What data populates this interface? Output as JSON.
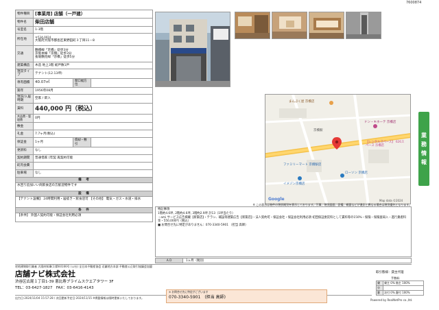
{
  "doc_id": "7600874",
  "property": {
    "type_label": "物件種目",
    "type_value": "[事業用] 店舗（一戸建）",
    "name_label": "物件名",
    "name_value": "柴田店舗",
    "room_label": "号室名",
    "room_value": "1-3階",
    "address_label": "所在地",
    "postal": "〒534-0024",
    "address_value": "大阪府大阪市都島区東野田町３丁目11－8",
    "traffic_label": "交通",
    "traffic_lines": [
      "鶴橋線「京橋」徒歩3分",
      "京阪本線「京橋」徒歩3分",
      "長堀鶴見緑「京橋」徒歩5分"
    ],
    "structure_label": "建築構造",
    "structure_value": "木造 地上3階 総戸数1戸",
    "current_label": "現況タイプ",
    "current_value": "テナント(12.13坪)",
    "area_label": "専有面積",
    "area_value": "40.07㎡",
    "frontage_label": "間口幅方位",
    "built_label": "築年",
    "built_value": "1956年08月",
    "condition_label": "現況/入居時期",
    "condition_value": "空家 / 即入",
    "rent_label": "賃料",
    "rent_value": "440,000 円（税込）",
    "common_label": "共益費・管理費",
    "common_value": "0円",
    "deposit_label": "敷金",
    "key_label": "礼金",
    "key_value": "7.7ヶ月(税込)",
    "guarantee_label": "保証金",
    "guarantee_value": "1ヶ月",
    "amort_label": "償却・敷引",
    "renewal_label": "更新料",
    "renewal_value": "なし",
    "contract_label": "契約期間",
    "contract_value": "普通借家 [年契 再契約可能",
    "town_label": "町内会費",
    "parking_label": "駐車場",
    "parking_value": "なし",
    "remarks_head": "備　考",
    "remarks_text": "水回り追加いい商飲食店の方歓迎物件です",
    "facility_head": "設　備",
    "facility_text": "【テナント設備】 24時間利用・居抜き・飲食店可 【その他】 電気・ガス・水道・排水",
    "condition_head": "条　件",
    "condition_text": "【条件】 外国人契約可能・保証会社利用必須"
  },
  "notice": "※ この表示は物件の現状概況を表示しております。万事、現況図面、設備、概要などが違反と異なる場合は現況優先となります。",
  "extra": {
    "title": "特記事項",
    "lines": [
      "1階約4.6坪, 2階約4.6坪, 3階約2.9坪 計13（1坪当たり）",
      "・ami サービス広告掲載【新築店】・テラン、補設等建築広告【新築店】・法人契約可・保証会社・保証会社利用必須 初回保証委託料として賃料等の150%・保険・保険査知入・進行業者料金・550,000円（税込）",
      "■ お問合せ先に特定がありません：070-3340-5901 （担当 高師）"
    ]
  },
  "av": {
    "label": "ＡＤ",
    "value": "1ヶ月（税別）"
  },
  "side_tab": [
    "業",
    "務",
    "情",
    "報"
  ],
  "map_labels": [
    "まんぷく屋 京橋店",
    "京橋駅",
    "ドン・キホーテ 京橋店",
    "ファミリーマート 京橋駅店",
    "ローソン 京橋店",
    "イメゾン京橋店",
    "【レンタルスペース】 626スペース 京橋店",
    "Google",
    "Map data ©2024"
  ],
  "footer": {
    "license": "宅地建物取引業者 大阪府知事(1)第60166号 (公社) 全日本不動産協会 近畿地方本部 不動産公正取引協議会加盟",
    "company": "店舗ナビ株式会社",
    "address": "渋谷区広尾１丁目1-39 恵比寿プライムスクエアタワー 3F",
    "tel": "TEL：03-6427-1827　FAX：03-6416-4143",
    "dates": "出力日:2024/11/04 15:57:28 / 次回更新予定日:2024/11/15 ※掲載情報は随時更新いたしております。",
    "contact_note": "※ お問合せ先に特定がございます",
    "contact_tel": "070-3340-5901　(担当 高師)",
    "powered": "Powered by RealNetPro co.,ltd.",
    "terms_head": "取引態様：貸主代理",
    "terms_caption": "手数料",
    "terms": [
      {
        "k": "貸",
        "v": "貸主 0%  借主 100%"
      },
      {
        "k": "分",
        "v": ""
      },
      {
        "k": "客",
        "v": "次付 0%  客付 100%"
      }
    ]
  }
}
